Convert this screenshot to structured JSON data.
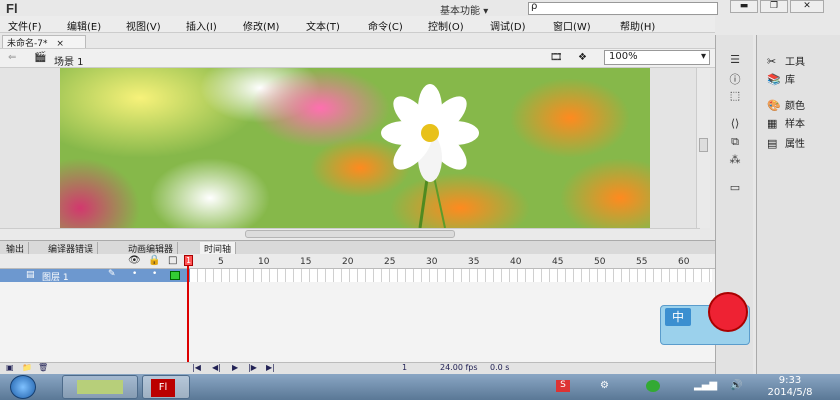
{
  "app": {
    "logo": "Fl",
    "workspace": "基本功能",
    "workspace_caret": "▾",
    "search_placeholder": "ρ"
  },
  "window_controls": {
    "minimize": "▬",
    "restore": "❐",
    "close": "✕"
  },
  "menu": [
    "文件(F)",
    "编辑(E)",
    "视图(V)",
    "插入(I)",
    "修改(M)",
    "文本(T)",
    "命令(C)",
    "控制(O)",
    "调试(D)",
    "窗口(W)",
    "帮助(H)"
  ],
  "document": {
    "tab_label": "未命名-7*",
    "close": "×",
    "scene": "场景 1",
    "zoom": "100%"
  },
  "panel_tabs": [
    "输出",
    "编译器错误",
    "动画编辑器",
    "时间轴"
  ],
  "timeline": {
    "layer_name": "图层 1",
    "frame_ticks": [
      "5",
      "10",
      "15",
      "20",
      "25",
      "30",
      "35",
      "40",
      "45",
      "50",
      "55",
      "60"
    ],
    "current_frame": "1",
    "footer_frame": "1",
    "fps": "24.00 fps",
    "time": "0.0 s"
  },
  "right_panel": {
    "items": [
      {
        "icon": "✂",
        "label": "工具"
      },
      {
        "icon": "📚",
        "label": "库"
      },
      {
        "icon": "🎨",
        "label": "颜色"
      },
      {
        "icon": "▦",
        "label": "样本"
      },
      {
        "icon": "▤",
        "label": "属性"
      }
    ]
  },
  "ime": {
    "label": "中"
  },
  "clock": {
    "time": "9:33",
    "date": "2014/5/8"
  }
}
